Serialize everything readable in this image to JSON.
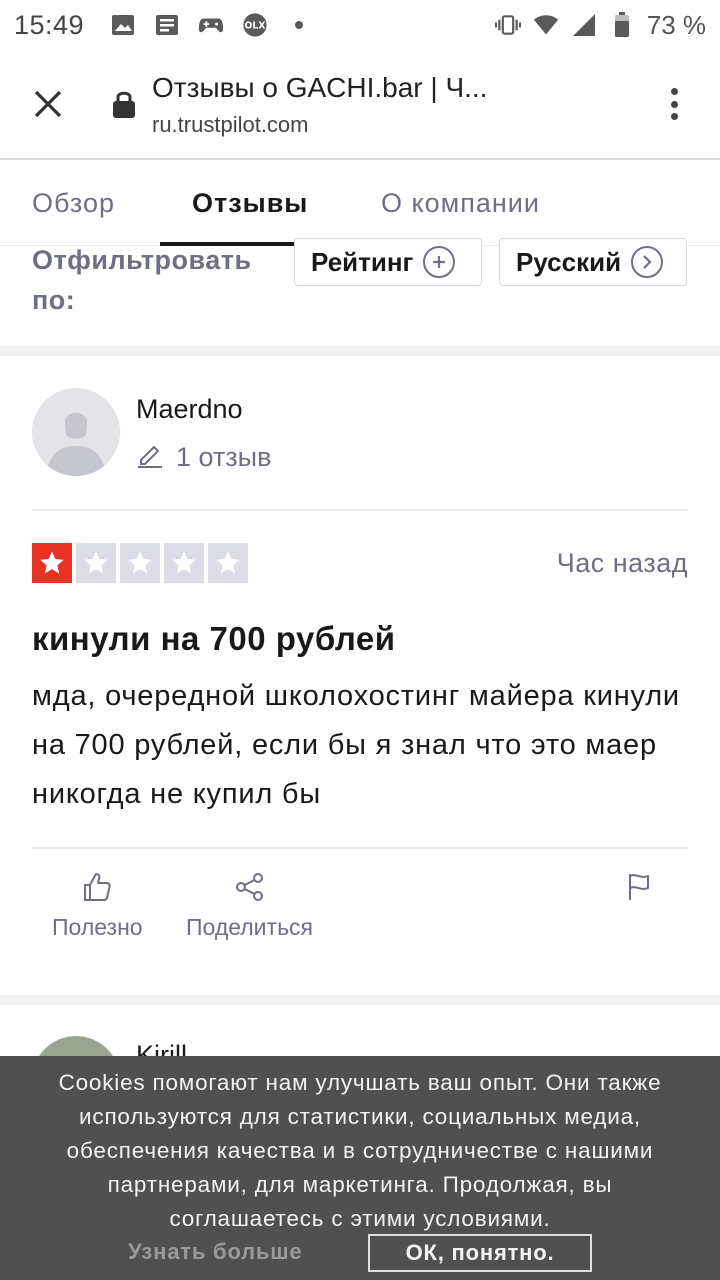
{
  "status_bar": {
    "time": "15:49",
    "battery_percent": "73 %",
    "notification_icons": [
      "image-icon",
      "news-icon",
      "game-controller-icon",
      "olx-icon",
      "dot-icon"
    ],
    "system_icons": [
      "vibrate-icon",
      "wifi-icon",
      "signal-icon",
      "battery-icon"
    ]
  },
  "browser": {
    "title": "Отзывы о GACHI.bar | Ч...",
    "url": "ru.trustpilot.com"
  },
  "tabs": [
    {
      "label": "Обзор",
      "active": false
    },
    {
      "label": "Отзывы",
      "active": true
    },
    {
      "label": "О компании",
      "active": false
    }
  ],
  "filter": {
    "label": "Отфильтровать по:",
    "rating_label": "Рейтинг",
    "language_label": "Русский"
  },
  "review": {
    "reviewer_name": "Maerdno",
    "review_count": "1 отзыв",
    "rating": 1,
    "max_rating": 5,
    "time": "Час назад",
    "title": "кинули на 700 рублей",
    "body": "мда, очередной школохостинг майера кинули на 700 рублей, если бы я знал что это маер никогда не купил бы",
    "actions": {
      "useful": "Полезно",
      "share": "Поделиться"
    }
  },
  "next_review": {
    "reviewer_name": "Kirill"
  },
  "cookie_banner": {
    "text": "Cookies помогают нам улучшать ваш опыт. Они также используются для статистики, социальных медиа, обеспечения качества и в сотрудничестве с нашими партнерами, для маркетинга. Продолжая, вы соглашаетесь с этими условиями.",
    "learn_more": "Узнать больше",
    "ok": "ОК, понятно."
  },
  "colors": {
    "star_active": "#e63323",
    "star_inactive": "#dcdce6",
    "muted_text": "#6f6f83",
    "cookie_bg": "#505050"
  }
}
